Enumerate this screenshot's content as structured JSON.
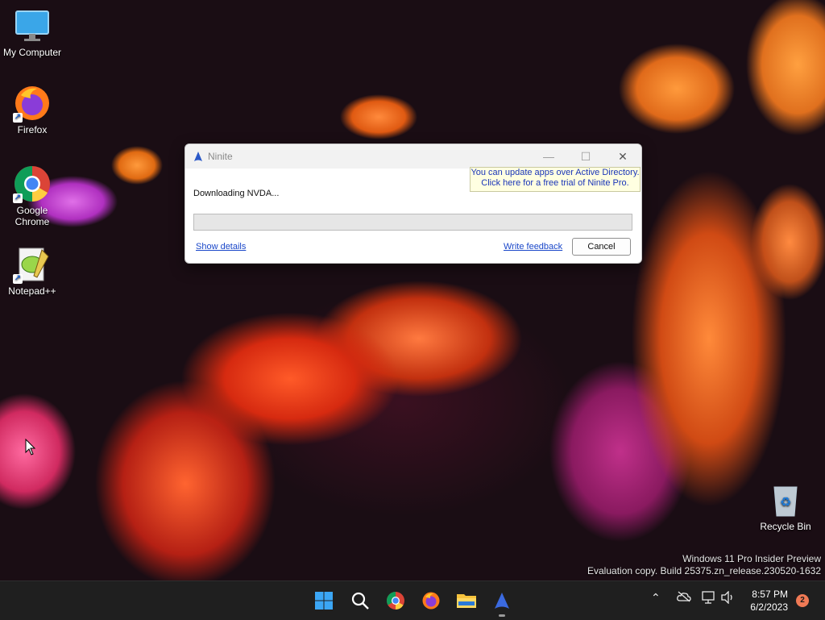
{
  "desktop": {
    "icons": [
      {
        "label": "My Computer",
        "icon": "monitor-icon"
      },
      {
        "label": "Firefox",
        "icon": "firefox-icon"
      },
      {
        "label": "Google Chrome",
        "icon": "chrome-icon"
      },
      {
        "label": "Notepad++",
        "icon": "notepad-plus-plus-icon"
      },
      {
        "label": "Recycle Bin",
        "icon": "recycle-bin-icon"
      }
    ],
    "watermark": {
      "line1": "Windows 11 Pro Insider Preview",
      "line2": "Evaluation copy. Build 25375.zn_release.230520-1632"
    }
  },
  "ninite": {
    "title": "Ninite",
    "minimize": "—",
    "maximize": "☐",
    "close": "✕",
    "ad_line1": "You can update apps over Active Directory.",
    "ad_line2": "Click here for a free trial of Ninite Pro.",
    "status": "Downloading NVDA...",
    "progress_fraction": 0,
    "show_details": "Show details",
    "write_feedback": "Write feedback",
    "cancel": "Cancel"
  },
  "taskbar": {
    "apps": [
      "start-icon",
      "search-icon",
      "chrome-icon",
      "firefox-icon",
      "file-explorer-icon",
      "ninite-icon"
    ],
    "time": "8:57 PM",
    "date": "6/2/2023",
    "notification_count": "2"
  }
}
